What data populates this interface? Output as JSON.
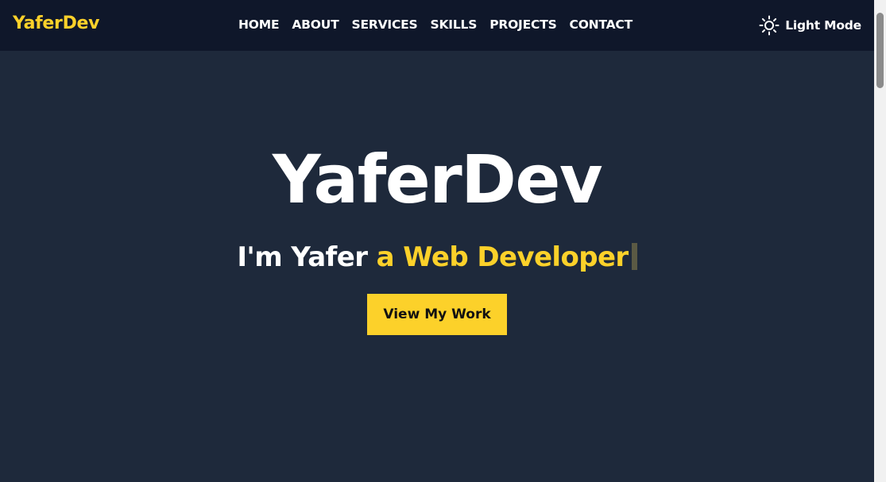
{
  "brand": {
    "name": "YaferDev"
  },
  "nav": {
    "items": [
      {
        "label": "HOME"
      },
      {
        "label": "ABOUT"
      },
      {
        "label": "SERVICES"
      },
      {
        "label": "SKILLS"
      },
      {
        "label": "PROJECTS"
      },
      {
        "label": "CONTACT"
      }
    ]
  },
  "theme_toggle": {
    "label": "Light Mode",
    "icon": "sun-icon"
  },
  "hero": {
    "title": "YaferDev",
    "subtitle_prefix": "I'm Yafer ",
    "subtitle_typed": "a Web Developer",
    "cta_label": "View My Work"
  },
  "colors": {
    "accent": "#fcd12a",
    "background": "#1e293b",
    "navbar": "#0f172a",
    "text": "#ffffff"
  }
}
